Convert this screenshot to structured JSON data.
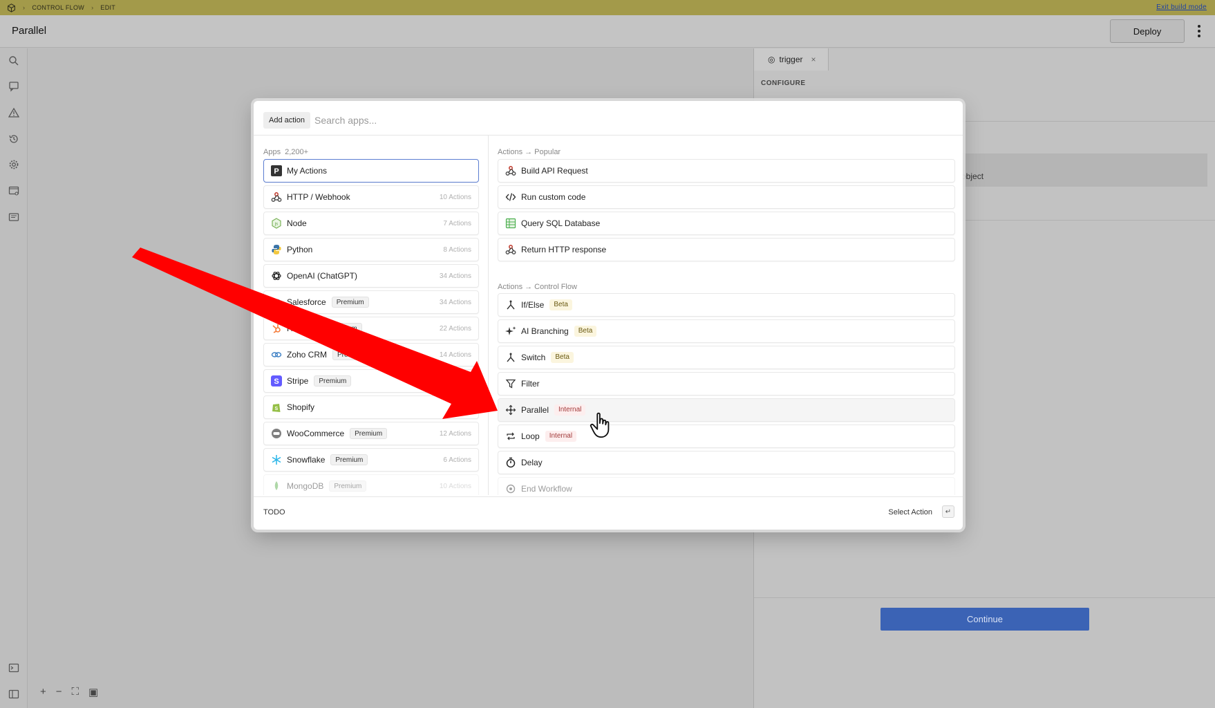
{
  "buildbar": {
    "breadcrumb": [
      "CONTROL FLOW",
      "EDIT"
    ],
    "exit_label": "Exit build mode"
  },
  "header": {
    "title": "Parallel",
    "deploy_label": "Deploy"
  },
  "right_panel": {
    "tab_label": "trigger",
    "configure_label": "CONFIGURE",
    "object_text": "object",
    "continue_label": "Continue"
  },
  "modal": {
    "add_action_label": "Add action",
    "search_placeholder": "Search apps...",
    "apps_title": "Apps",
    "apps_count": "2,200+",
    "apps": [
      {
        "label": "My Actions",
        "meta": "",
        "badge": "",
        "icon": "pipedream-icon"
      },
      {
        "label": "HTTP / Webhook",
        "meta": "10 Actions",
        "badge": "",
        "icon": "webhook-icon"
      },
      {
        "label": "Node",
        "meta": "7 Actions",
        "badge": "",
        "icon": "nodejs-icon"
      },
      {
        "label": "Python",
        "meta": "8 Actions",
        "badge": "",
        "icon": "python-icon"
      },
      {
        "label": "OpenAI (ChatGPT)",
        "meta": "34 Actions",
        "badge": "",
        "icon": "openai-icon"
      },
      {
        "label": "Salesforce",
        "meta": "34 Actions",
        "badge": "Premium",
        "icon": "salesforce-icon"
      },
      {
        "label": "HubSpot",
        "meta": "22 Actions",
        "badge": "Premium",
        "icon": "hubspot-icon"
      },
      {
        "label": "Zoho CRM",
        "meta": "14 Actions",
        "badge": "Premium",
        "icon": "zoho-icon"
      },
      {
        "label": "Stripe",
        "meta": "",
        "badge": "Premium",
        "icon": "stripe-icon"
      },
      {
        "label": "Shopify",
        "meta": "",
        "badge": "",
        "icon": "shopify-icon"
      },
      {
        "label": "WooCommerce",
        "meta": "12 Actions",
        "badge": "Premium",
        "icon": "woocommerce-icon"
      },
      {
        "label": "Snowflake",
        "meta": "6 Actions",
        "badge": "Premium",
        "icon": "snowflake-icon"
      },
      {
        "label": "MongoDB",
        "meta": "10 Actions",
        "badge": "Premium",
        "icon": "mongodb-icon"
      }
    ],
    "popular_title": "Actions → Popular",
    "popular": [
      {
        "label": "Build API Request",
        "icon": "webhook-icon"
      },
      {
        "label": "Run custom code",
        "icon": "code-icon"
      },
      {
        "label": "Query SQL Database",
        "icon": "sheet-icon"
      },
      {
        "label": "Return HTTP response",
        "icon": "webhook-icon"
      }
    ],
    "control_title": "Actions → Control Flow",
    "control": [
      {
        "label": "If/Else",
        "badge": "Beta",
        "icon": "branch-icon"
      },
      {
        "label": "AI Branching",
        "badge": "Beta",
        "icon": "sparkle-icon"
      },
      {
        "label": "Switch",
        "badge": "Beta",
        "icon": "branch-icon"
      },
      {
        "label": "Filter",
        "badge": "",
        "icon": "filter-icon"
      },
      {
        "label": "Parallel",
        "badge": "Internal",
        "icon": "parallel-icon"
      },
      {
        "label": "Loop",
        "badge": "Internal",
        "icon": "loop-icon"
      },
      {
        "label": "Delay",
        "badge": "",
        "icon": "timer-icon"
      },
      {
        "label": "End Workflow",
        "badge": "",
        "icon": "end-icon"
      }
    ],
    "footer_left": "TODO",
    "footer_right": "Select Action",
    "footer_key": "↵"
  },
  "colors": {
    "buildbar": "#a39a4a",
    "continue": "#3b63b5",
    "arrow": "#ff0000",
    "beta_badge": "#fbf5de",
    "internal_badge": "#fdeeee"
  }
}
